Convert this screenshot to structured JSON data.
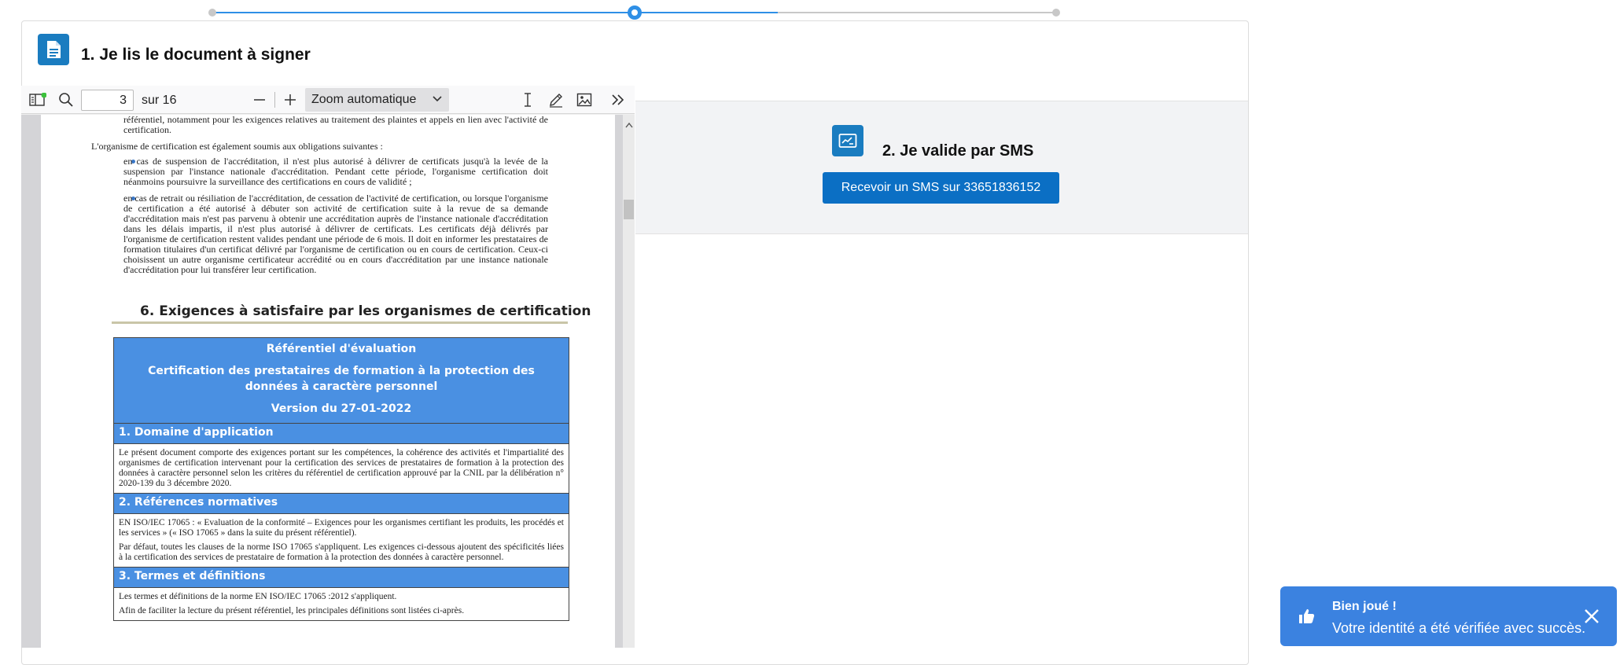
{
  "app": {
    "step1_title": "1. Je lis le document à signer",
    "step2_title": "2. Je valide par SMS",
    "sms_button_label": "Recevoir un SMS sur 33651836152"
  },
  "stepper": {
    "steps": 3,
    "active_step": 2,
    "progress_fraction": 0.6,
    "color_active": "#2e8fe6",
    "color_inactive": "#c8c8c8"
  },
  "viewer": {
    "page_value": "3",
    "page_total": "sur 16",
    "zoom_label": "Zoom automatique",
    "icons": [
      "sidebar-toggle-icon",
      "search-icon",
      "zoom-out-icon",
      "zoom-in-icon",
      "text-cursor-icon",
      "pen-icon",
      "image-icon",
      "more-tools-icon"
    ]
  },
  "document": {
    "p1": "référentiel, notamment pour les exigences relatives au traitement des plaintes et appels en lien avec l'activité de certification.",
    "p2": "L'organisme de certification est également soumis aux obligations suivantes :",
    "b1": "en cas de suspension de l'accréditation, il n'est plus autorisé à délivrer de certificats jusqu'à la levée de la suspension par l'instance nationale d'accréditation. Pendant cette période, l'organisme certification doit néanmoins poursuivre la surveillance des certifications en cours de validité ;",
    "b2": "en cas de retrait ou résiliation de l'accréditation, de cessation de l'activité de certification, ou lorsque l'organisme de certification a été autorisé à débuter son activité de certification suite à la revue de sa demande d'accréditation mais n'est pas parvenu à obtenir une accréditation auprès de l'instance nationale d'accréditation dans les délais impartis, il n'est plus autorisé à délivrer de certificats. Les certificats déjà délivrés par l'organisme de certification restent valides pendant une période de 6 mois. Il doit en informer les prestataires de formation titulaires d'un certificat délivré par l'organisme de certification ou en cours de certification. Ceux-ci choisissent un autre organisme certificateur accrédité ou en cours d'accréditation par une instance nationale d'accréditation pour lui transférer leur certification.",
    "section_heading": "6.  Exigences à satisfaire par les organismes de certification",
    "table_header_1": "Référentiel d'évaluation",
    "table_header_2": "Certification des prestataires de formation à la protection des données à caractère personnel",
    "table_header_3": "Version du 27-01-2022",
    "s1_title": "1. Domaine d'application",
    "s1_body": "Le présent document comporte des exigences portant sur les compétences, la cohérence des activités et l'impartialité des organismes de certification intervenant pour la certification des services de prestataires de formation à la protection des données à caractère personnel selon les critères du référentiel de certification approuvé par la CNIL par la délibération n° 2020-139 du 3 décembre 2020.",
    "s2_title": "2. Références normatives",
    "s2_body_1": "EN ISO/IEC 17065 : « Evaluation de la conformité – Exigences pour les organismes certifiant les produits, les procédés et les services » (« ISO 17065 » dans la suite du présent référentiel).",
    "s2_body_2": "Par défaut, toutes les clauses de la norme ISO 17065 s'appliquent. Les exigences ci-dessous ajoutent des spécificités liées à la certification des services de prestataire de formation à la protection des données à caractère personnel.",
    "s3_title": "3. Termes et définitions",
    "s3_body_1": "Les termes et définitions de la norme EN ISO/IEC 17065 :2012 s'appliquent.",
    "s3_body_2": "Afin de faciliter la lecture du présent référentiel, les principales définitions sont listées ci-après."
  },
  "toast": {
    "title": "Bien joué !",
    "message": "Votre identité a été vérifiée avec succès.",
    "icon": "thumbs-up-icon",
    "color": "#3b82e0"
  }
}
